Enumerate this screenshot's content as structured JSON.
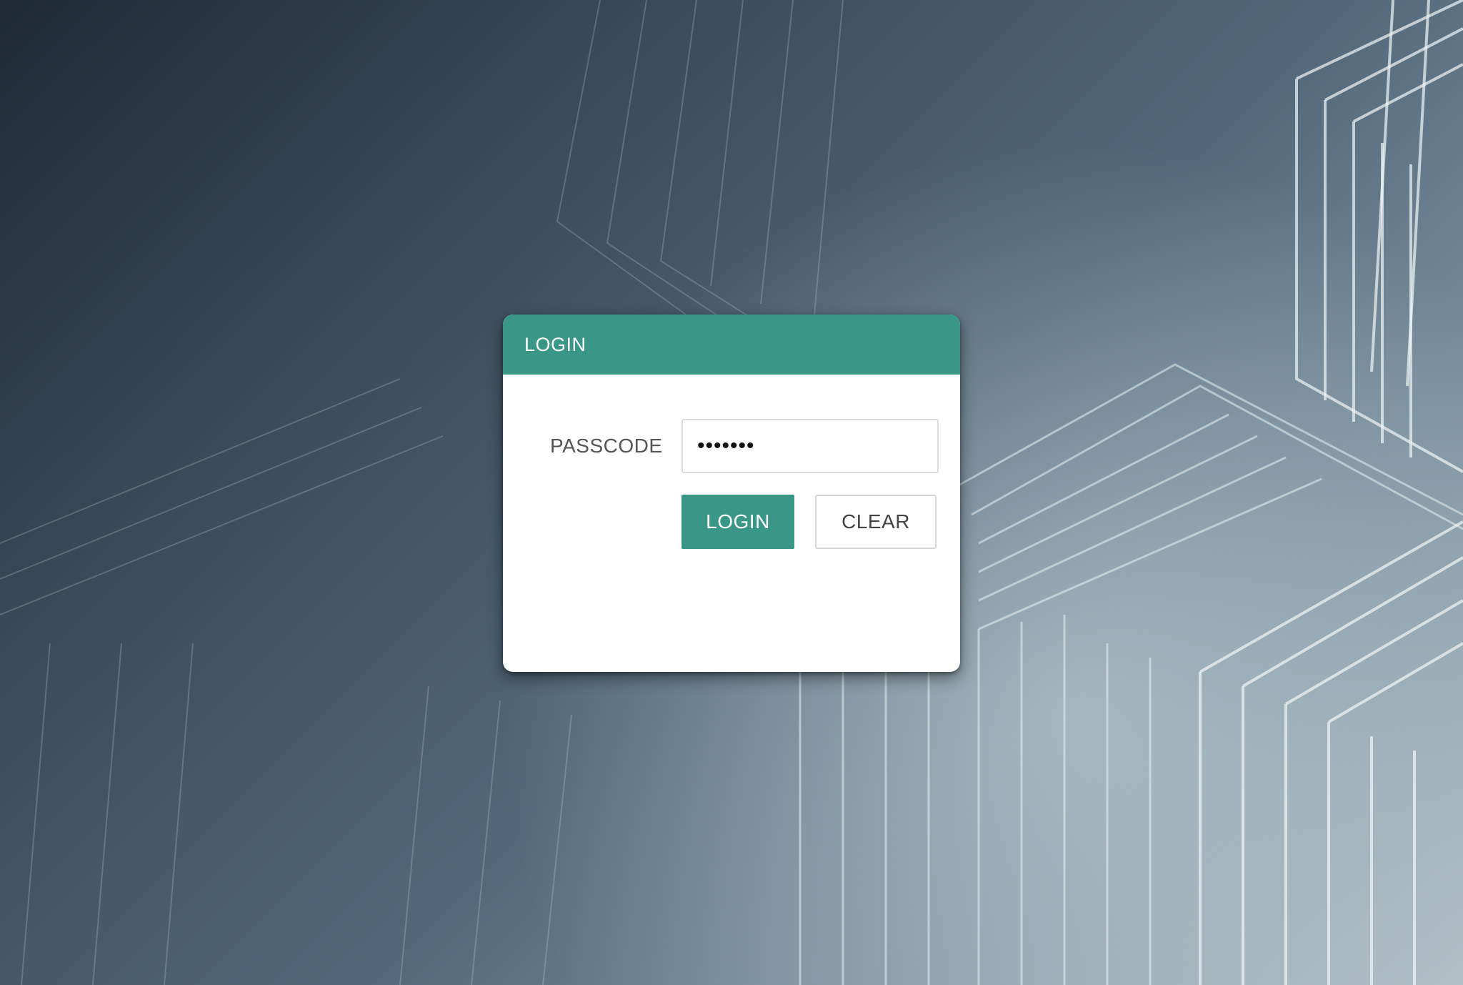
{
  "colors": {
    "accent": "#3a9686",
    "card_background": "#ffffff",
    "label_text": "#555555"
  },
  "background": {
    "icon": "abstract-line-pattern"
  },
  "login_panel": {
    "title": "LOGIN",
    "passcode": {
      "label": "PASSCODE",
      "value": "•••••••",
      "masked": true
    },
    "buttons": {
      "login_label": "LOGIN",
      "clear_label": "CLEAR"
    }
  }
}
